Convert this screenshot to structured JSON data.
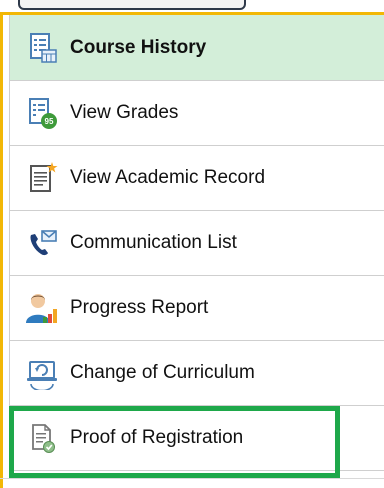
{
  "menu": {
    "items": [
      {
        "label": "Course History",
        "icon": "course-history-icon",
        "active": true
      },
      {
        "label": "View Grades",
        "icon": "grades-icon",
        "active": false
      },
      {
        "label": "View Academic Record",
        "icon": "academic-record-icon",
        "active": false
      },
      {
        "label": "Communication List",
        "icon": "communication-icon",
        "active": false
      },
      {
        "label": "Progress Report",
        "icon": "progress-report-icon",
        "active": false
      },
      {
        "label": "Change of Curriculum",
        "icon": "change-curriculum-icon",
        "active": false
      },
      {
        "label": "Proof of Registration",
        "icon": "proof-registration-icon",
        "active": false
      }
    ]
  },
  "colors": {
    "active_bg": "#d3eed9",
    "frame_accent": "#f2b705",
    "highlight_box": "#1ea84a"
  }
}
